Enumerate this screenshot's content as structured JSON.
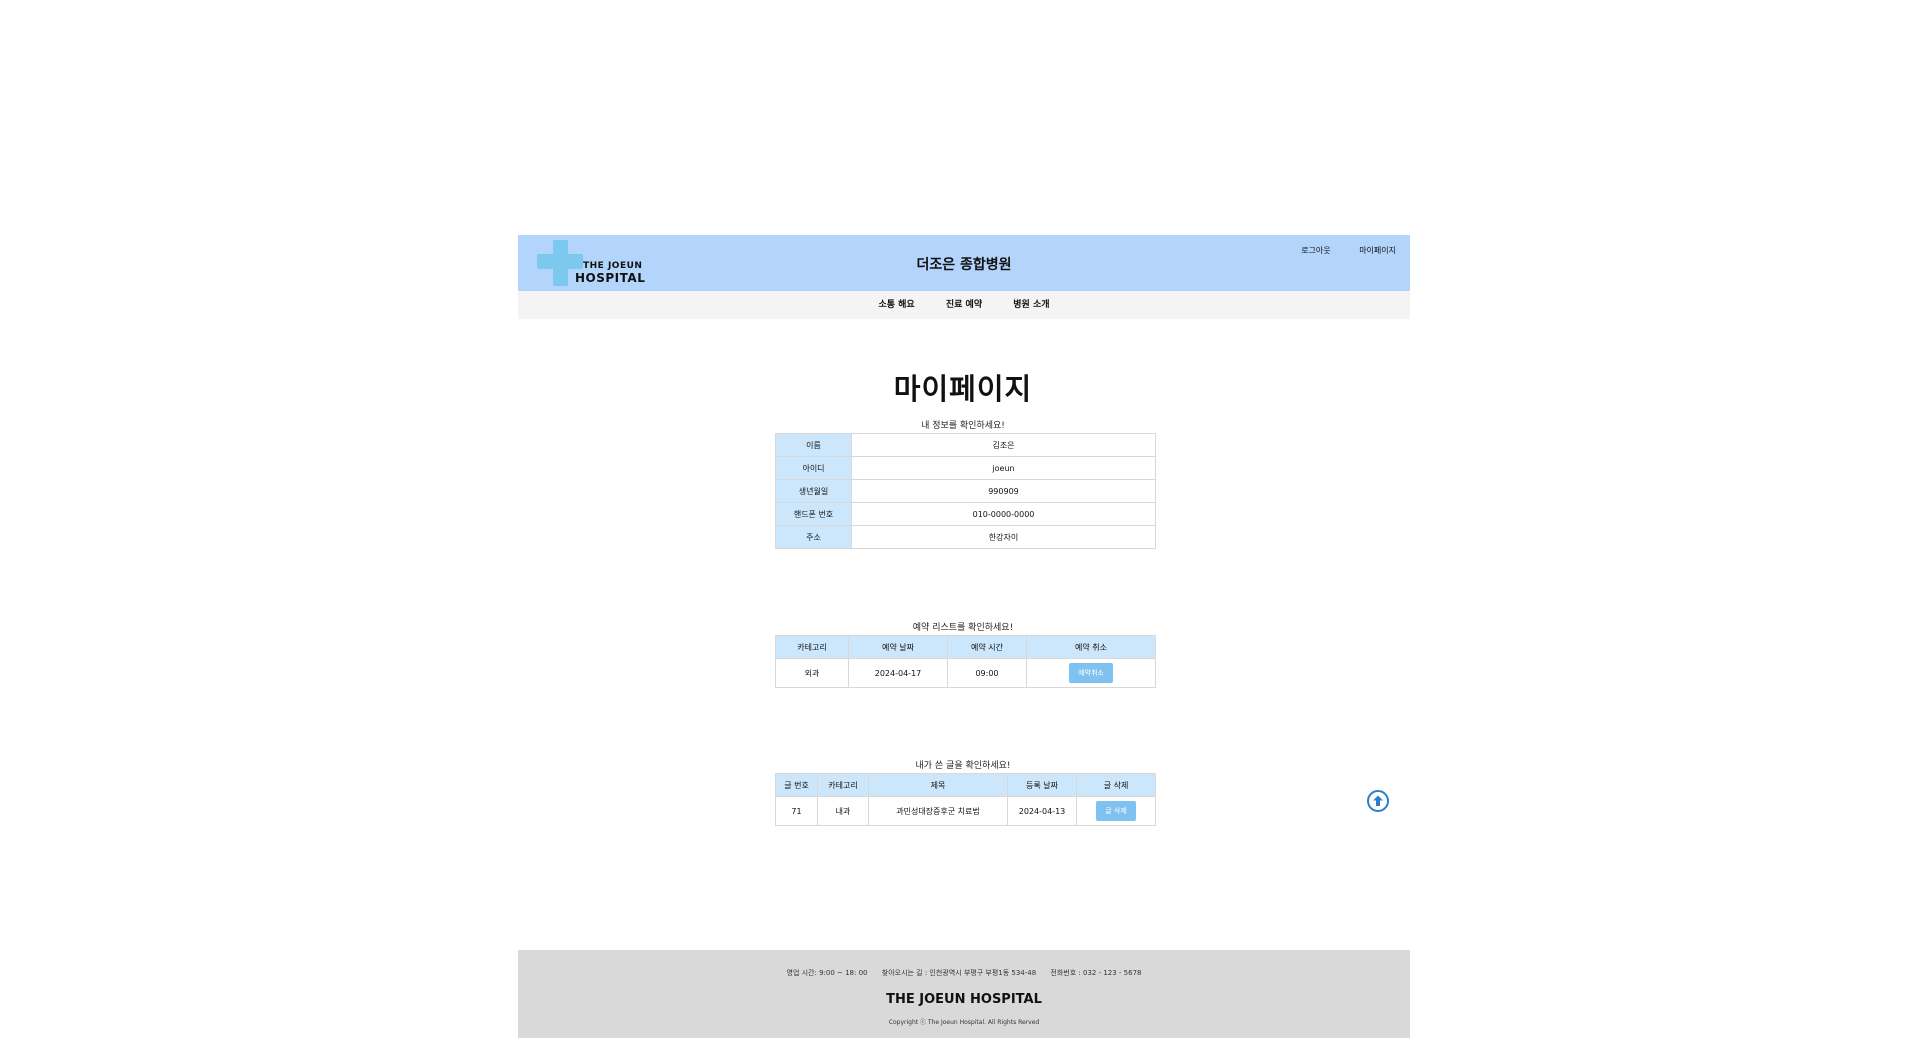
{
  "header": {
    "logo_line1": "THE JOEUN",
    "logo_line2": "HOSPITAL",
    "title": "더조은 종합병원",
    "logout": "로그아웃",
    "mypage": "마이페이지"
  },
  "nav": {
    "items": [
      "소통 해요",
      "진료 예약",
      "병원 소개"
    ]
  },
  "page_title": "마이페이지",
  "info": {
    "caption": "내 정보를 확인하세요!",
    "rows": [
      {
        "label": "이름",
        "value": "김조은"
      },
      {
        "label": "아이디",
        "value": "joeun"
      },
      {
        "label": "생년월일",
        "value": "990909"
      },
      {
        "label": "핸드폰 번호",
        "value": "010-0000-0000"
      },
      {
        "label": "주소",
        "value": "한강자이"
      }
    ]
  },
  "reservations": {
    "caption": "예약 리스트를 확인하세요!",
    "headers": [
      "카테고리",
      "예약 날짜",
      "예약 시간",
      "예약 취소"
    ],
    "rows": [
      {
        "category": "외과",
        "date": "2024-04-17",
        "time": "09:00",
        "action": "예약취소"
      }
    ]
  },
  "posts": {
    "caption": "내가 쓴 글을 확인하세요!",
    "headers": [
      "글 번호",
      "카테고리",
      "제목",
      "등록 날짜",
      "글 삭제"
    ],
    "rows": [
      {
        "no": "71",
        "category": "내과",
        "title": "과민성대장증후군 치료법",
        "date": "2024-04-13",
        "action": "글 삭제"
      }
    ]
  },
  "footer": {
    "hours": "영업 시간: 9:00 ~ 18: 00",
    "address": "찾아오시는 길 : 인천광역시 부평구 부평1동 534-48",
    "phone": "전화번호 : 032 - 123 - 5678",
    "brand": "THE JOEUN HOSPITAL",
    "copyright": "Copyright ⓒ The Joeun Hospital. All Rights Rerved"
  },
  "colors": {
    "header_bg": "#b3d4fb",
    "table_head_bg": "#cce6fb",
    "button_bg": "#7fc2f2",
    "footer_bg": "#d9d9d9",
    "scroll_icon": "#2a7fc9"
  },
  "icons": {
    "logo": "medical-cross-logo",
    "scroll_top": "arrow-up-circle-icon"
  }
}
